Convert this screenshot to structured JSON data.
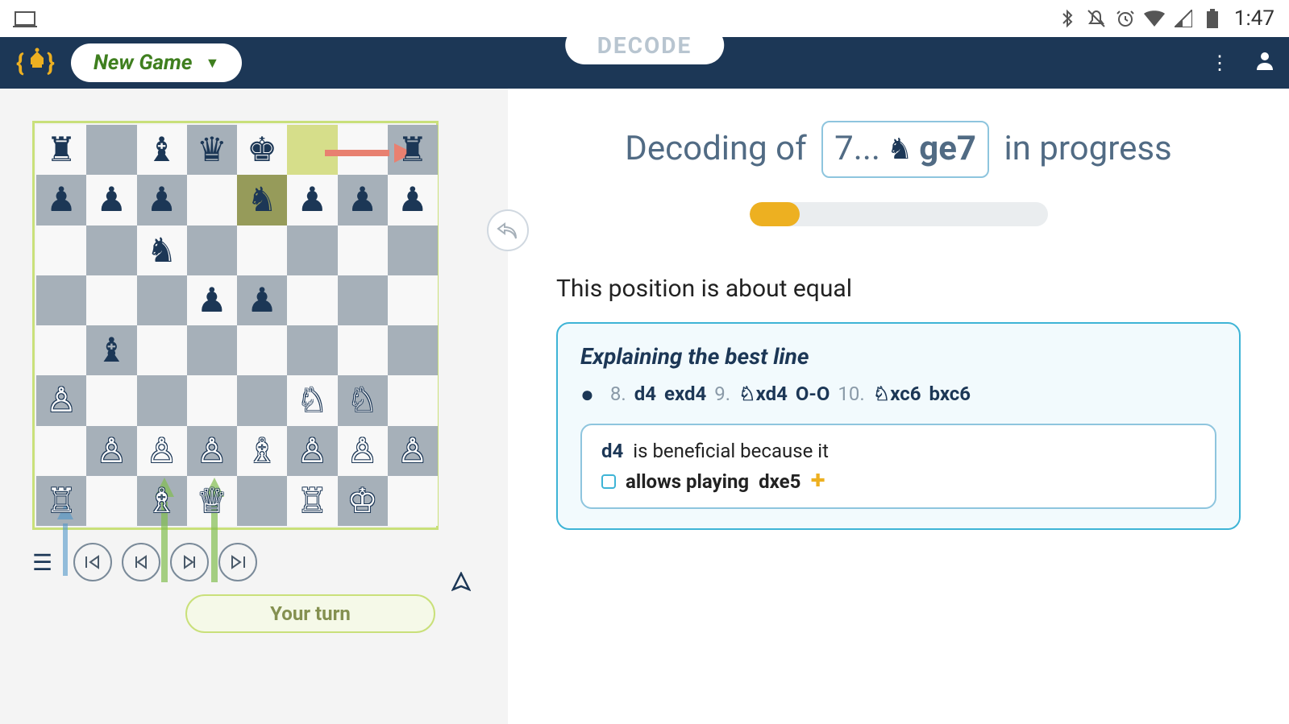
{
  "status": {
    "time": "1:47"
  },
  "app_bar": {
    "new_game": "New Game",
    "decode": "DECODE"
  },
  "board": {
    "pieces": [
      [
        "br",
        "",
        "bb",
        "bq",
        "bk",
        "",
        "",
        "br"
      ],
      [
        "bp",
        "bp",
        "bp",
        "",
        "bn",
        "bp",
        "bp",
        "bp"
      ],
      [
        "",
        "",
        "bn",
        "",
        "",
        "",
        "",
        ""
      ],
      [
        "",
        "",
        "",
        "bp",
        "bp",
        "",
        "",
        ""
      ],
      [
        "",
        "bb",
        "",
        "",
        "",
        "",
        "",
        ""
      ],
      [
        "wp",
        "",
        "",
        "",
        "",
        "wn",
        "wn",
        ""
      ],
      [
        "",
        "wp",
        "wp",
        "wp",
        "wb",
        "wp",
        "wp",
        "wp"
      ],
      [
        "wr",
        "",
        "wb",
        "wq",
        "",
        "wr",
        "wk",
        ""
      ]
    ],
    "turn_label": "Your turn"
  },
  "decode": {
    "header_before": "Decoding of",
    "header_move_prefix": "7...",
    "header_move_text": "ge7",
    "header_after": "in progress",
    "progress_percent": 17
  },
  "eval_text": "This position is about equal",
  "best_line": {
    "title": "Explaining the best line",
    "moves": [
      {
        "num": "8.",
        "text": "d4"
      },
      {
        "text": "exd4"
      },
      {
        "num": "9.",
        "icon": "knight",
        "text": "xd4"
      },
      {
        "text": "O-O"
      },
      {
        "num": "10.",
        "icon": "knight",
        "text": "xc6"
      },
      {
        "text": "bxc6"
      }
    ],
    "reason": {
      "move": "d4",
      "line1_rest": "is beneficial because it",
      "line2_main": "allows playing",
      "line2_move": "dxe5"
    }
  }
}
